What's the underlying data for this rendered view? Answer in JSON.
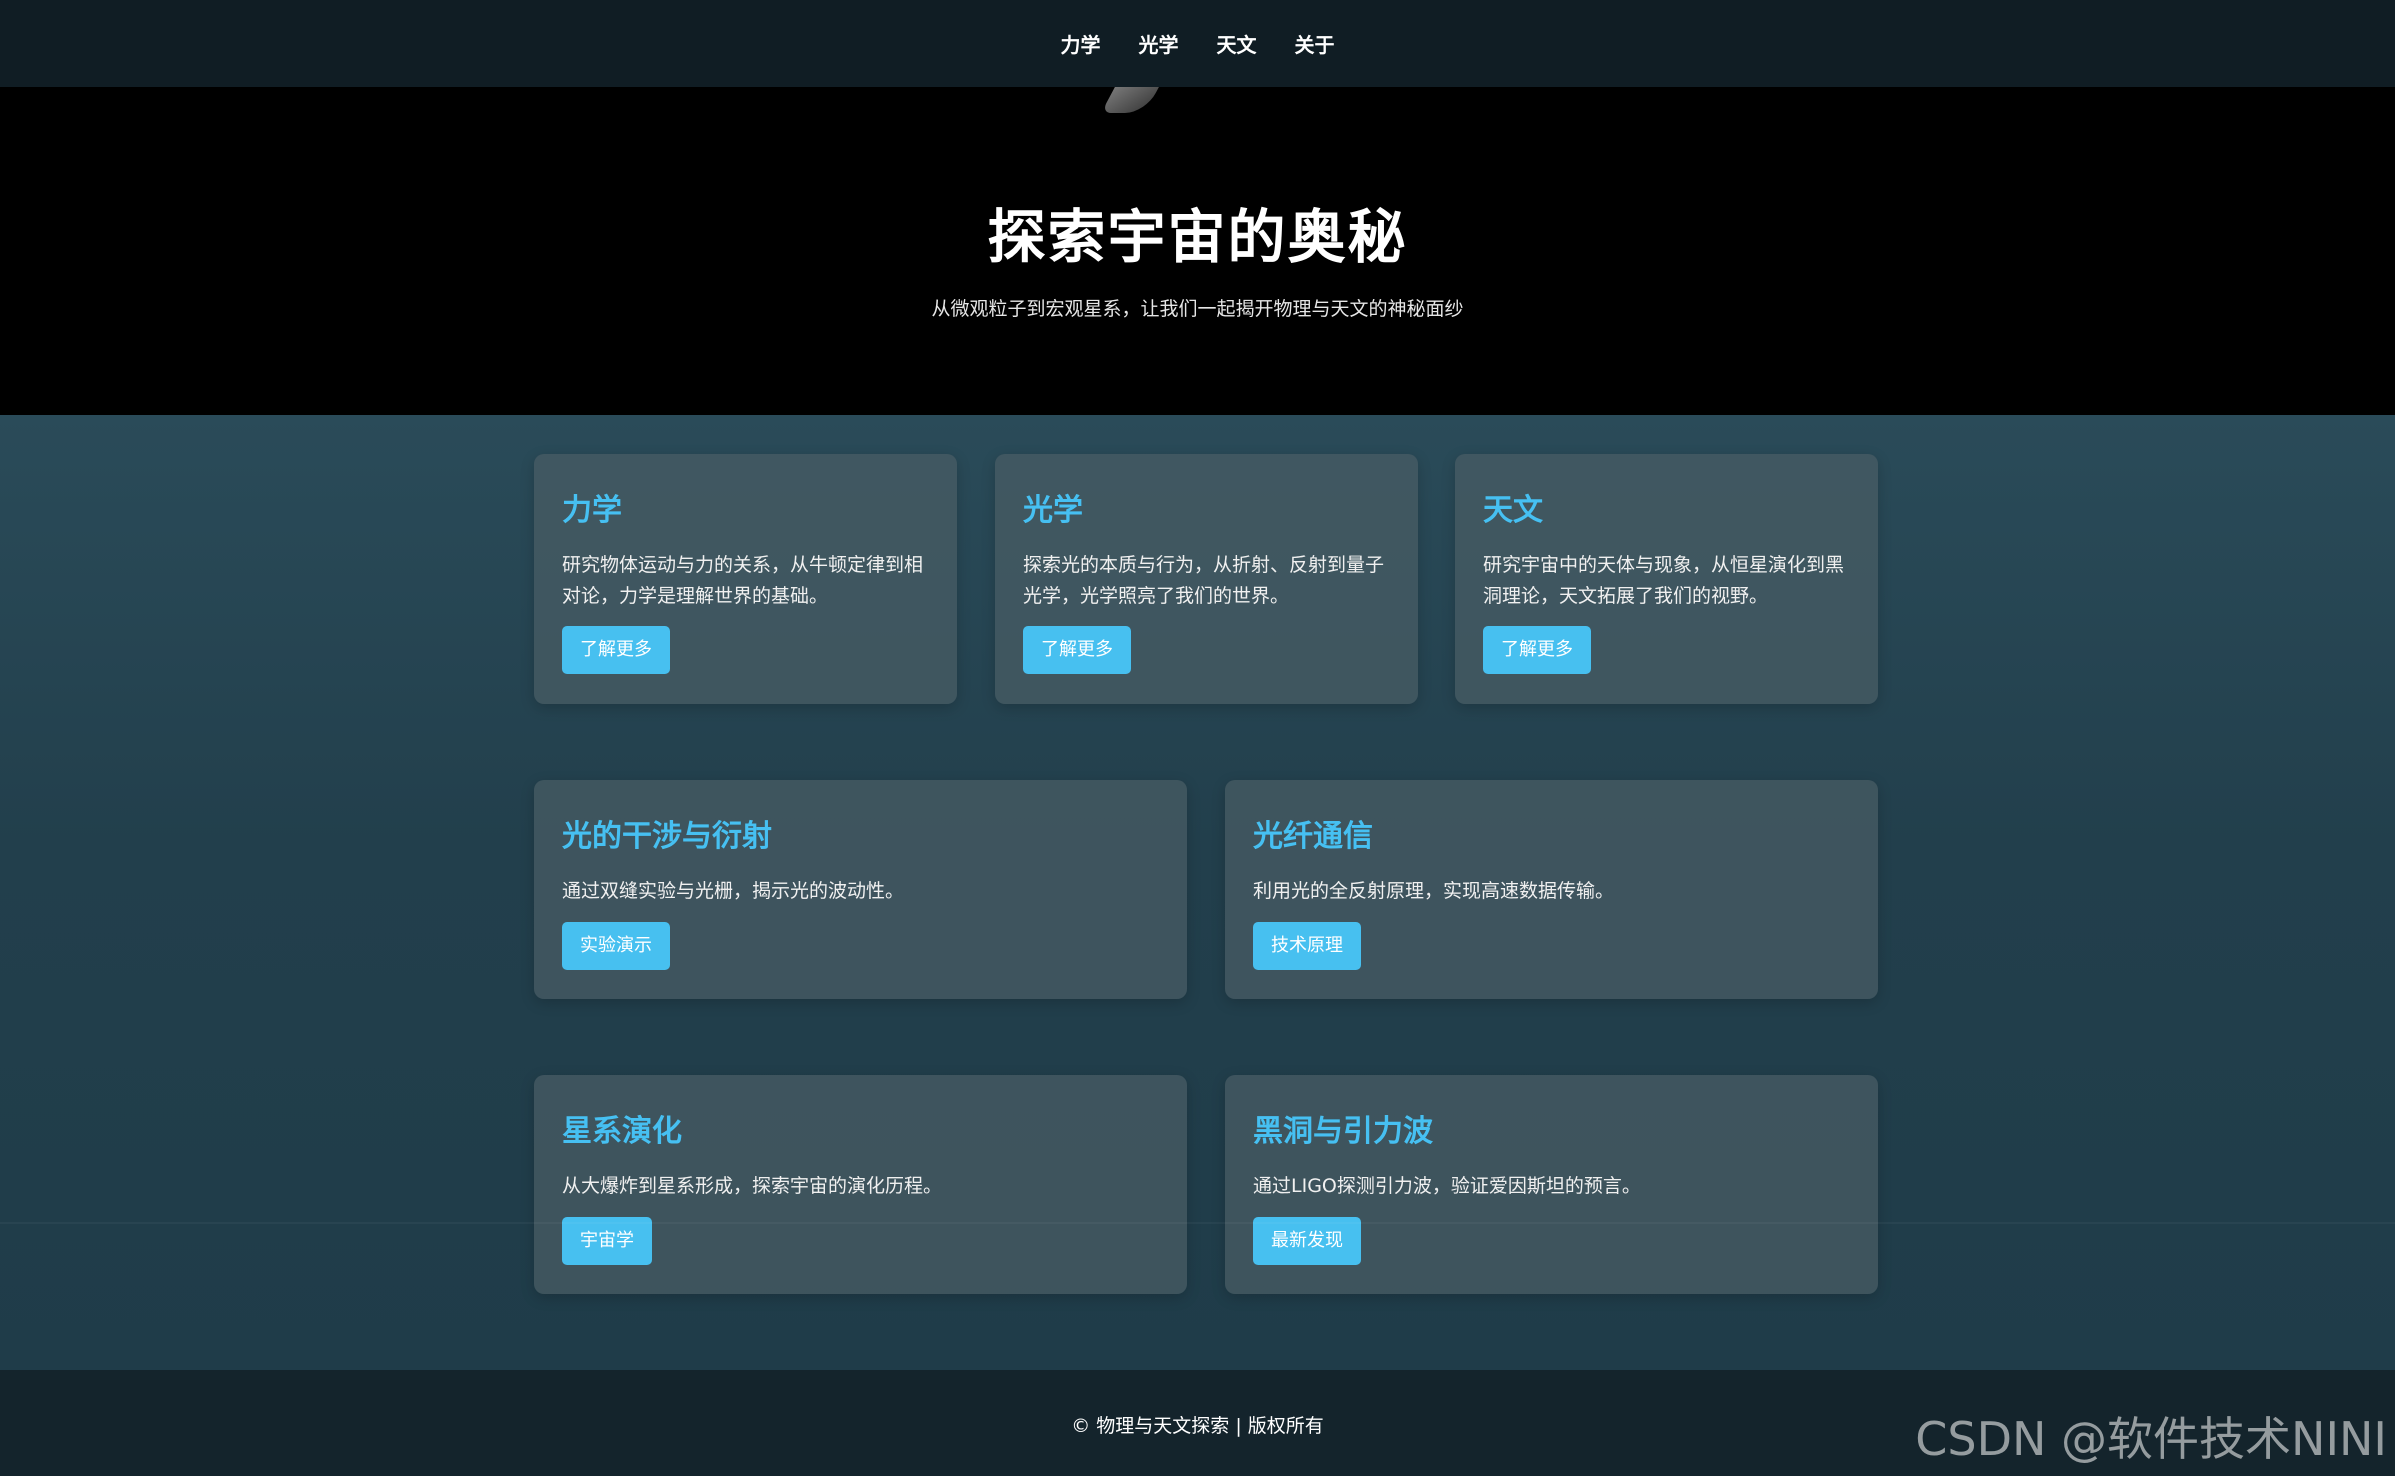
{
  "nav": {
    "items": [
      {
        "label": "力学"
      },
      {
        "label": "光学"
      },
      {
        "label": "天文"
      },
      {
        "label": "关于"
      }
    ]
  },
  "hero": {
    "title": "探索宇宙的奥秘",
    "subtitle": "从微观粒子到宏观星系，让我们一起揭开物理与天文的神秘面纱"
  },
  "cards": [
    {
      "title": "力学",
      "desc": "研究物体运动与力的关系，从牛顿定律到相对论，力学是理解世界的基础。",
      "button": "了解更多"
    },
    {
      "title": "光学",
      "desc": "探索光的本质与行为，从折射、反射到量子光学，光学照亮了我们的世界。",
      "button": "了解更多"
    },
    {
      "title": "天文",
      "desc": "研究宇宙中的天体与现象，从恒星演化到黑洞理论，天文拓展了我们的视野。",
      "button": "了解更多"
    },
    {
      "title": "光的干涉与衍射",
      "desc": "通过双缝实验与光栅，揭示光的波动性。",
      "button": "实验演示"
    },
    {
      "title": "光纤通信",
      "desc": "利用光的全反射原理，实现高速数据传输。",
      "button": "技术原理"
    },
    {
      "title": "星系演化",
      "desc": "从大爆炸到星系形成，探索宇宙的演化历程。",
      "button": "宇宙学"
    },
    {
      "title": "黑洞与引力波",
      "desc": "通过LIGO探测引力波，验证爱因斯坦的预言。",
      "button": "最新发现"
    }
  ],
  "footer": {
    "text": "© 物理与天文探索 | 版权所有"
  },
  "watermark": "CSDN @软件技术NINI",
  "colors": {
    "accent": "#47c0f0",
    "nav_bg": "#101d24",
    "hero_bg": "#000000",
    "footer_bg": "#14242c"
  }
}
